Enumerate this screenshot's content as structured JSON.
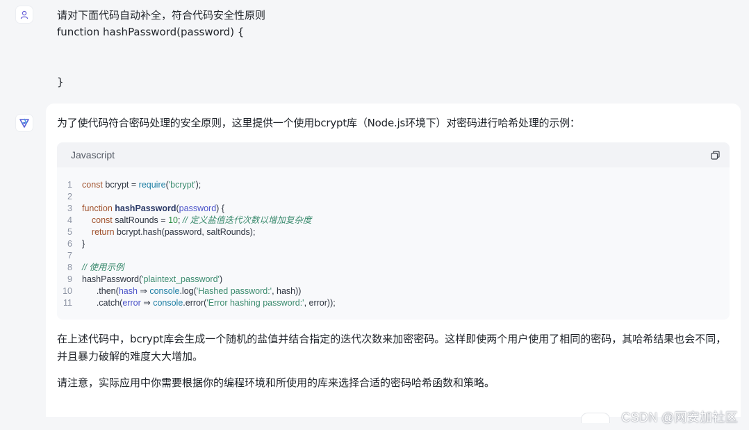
{
  "user": {
    "lines": [
      "请对下面代码自动补全，符合代码安全性原则",
      "function hashPassword(password) {",
      "",
      "",
      "}"
    ]
  },
  "assistant": {
    "intro": "为了使代码符合密码处理的安全原则，这里提供一个使用bcrypt库（Node.js环境下）对密码进行哈希处理的示例：",
    "code": {
      "language": "Javascript",
      "line_numbers": [
        "1",
        "2",
        "3",
        "4",
        "5",
        "6",
        "7",
        "8",
        "9",
        "10",
        "11"
      ]
    },
    "para1": "在上述代码中，bcrypt库会生成一个随机的盐值并结合指定的迭代次数来加密密码。这样即使两个用户使用了相同的密码，其哈希结果也会不同，并且暴力破解的难度大大增加。",
    "para2": "请注意，实际应用中你需要根据你的编程环境和所使用的库来选择合适的密码哈希函数和策略。"
  },
  "watermark": "CSDN @网安加社区",
  "colors": {
    "background": "#f5f6f8",
    "card": "#ffffff",
    "code_bg": "#f8f9fb",
    "keyword": "#a0522d",
    "string": "#3b8b6e",
    "param": "#4b54c9",
    "builtin": "#1d7ea3"
  },
  "icons": [
    "user-icon",
    "assistant-logo-icon",
    "copy-icon"
  ]
}
